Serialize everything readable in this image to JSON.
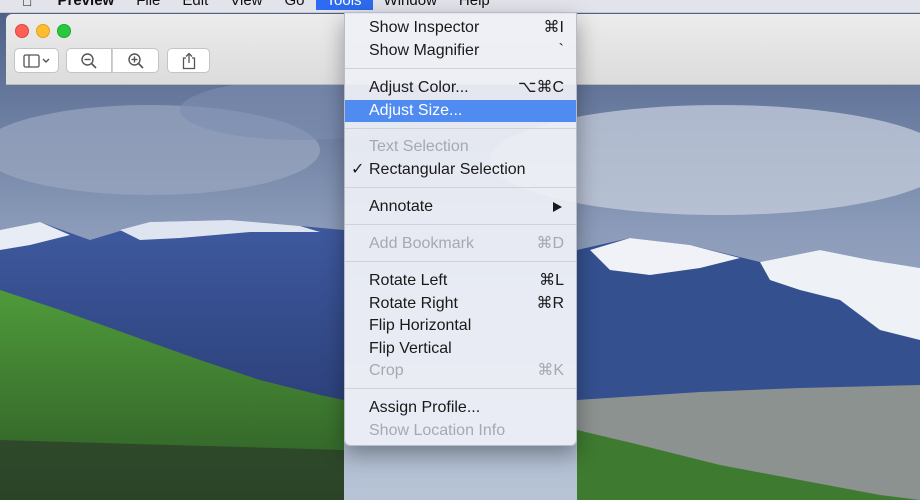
{
  "menubar": {
    "apple": "",
    "app": "Preview",
    "items": [
      "File",
      "Edit",
      "View",
      "Go",
      "Tools",
      "Window",
      "Help"
    ],
    "active": "Tools"
  },
  "tools_menu": {
    "show_inspector": {
      "label": "Show Inspector",
      "shortcut": "⌘I"
    },
    "show_magnifier": {
      "label": "Show Magnifier",
      "shortcut": "`"
    },
    "adjust_color": {
      "label": "Adjust Color...",
      "shortcut": "⌥⌘C"
    },
    "adjust_size": {
      "label": "Adjust Size..."
    },
    "text_selection": {
      "label": "Text Selection"
    },
    "rectangular_selection": {
      "label": "Rectangular Selection",
      "check": "✓"
    },
    "annotate": {
      "label": "Annotate"
    },
    "add_bookmark": {
      "label": "Add Bookmark",
      "shortcut": "⌘D"
    },
    "rotate_left": {
      "label": "Rotate Left",
      "shortcut": "⌘L"
    },
    "rotate_right": {
      "label": "Rotate Right",
      "shortcut": "⌘R"
    },
    "flip_horizontal": {
      "label": "Flip Horizontal"
    },
    "flip_vertical": {
      "label": "Flip Vertical"
    },
    "crop": {
      "label": "Crop",
      "shortcut": "⌘K"
    },
    "assign_profile": {
      "label": "Assign Profile..."
    },
    "show_location_info": {
      "label": "Show Location Info"
    }
  },
  "toolbar": {
    "icons": [
      "sidebar-icon",
      "zoom-out-icon",
      "zoom-in-icon",
      "share-icon"
    ]
  },
  "colors": {
    "highlight": "#4f8bf0",
    "menubar_active": "#2d6cf0",
    "disabled_text": "#a7a9b0"
  }
}
